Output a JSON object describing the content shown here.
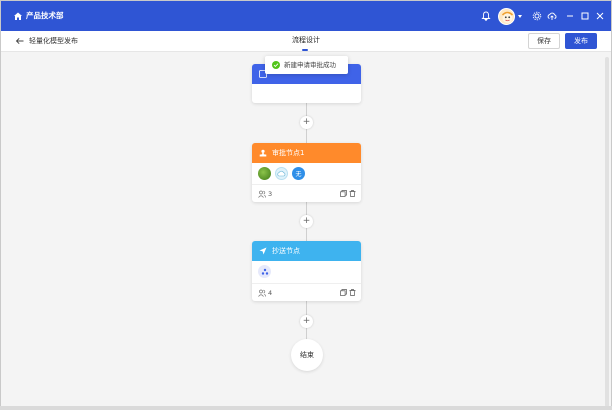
{
  "app": {
    "title": "产品技术部"
  },
  "header": {
    "page_title": "轻量化模型发布",
    "tab": "流程设计",
    "save_label": "保存",
    "publish_label": "发布"
  },
  "toast": {
    "message": "新建申请审批成功"
  },
  "nodes": [
    {
      "kind": "start",
      "title": "",
      "color": "#3f63e8"
    },
    {
      "kind": "approver",
      "title": "审批节点1",
      "color": "#ff8a2b",
      "count": "3",
      "avatar_text": "无"
    },
    {
      "kind": "cc",
      "title": "抄送节点",
      "color": "#3eb3ef",
      "count": "4"
    }
  ],
  "end_label": "结束",
  "add_label": "+",
  "colors": {
    "primary": "#2f55d4",
    "success": "#52c41a"
  }
}
